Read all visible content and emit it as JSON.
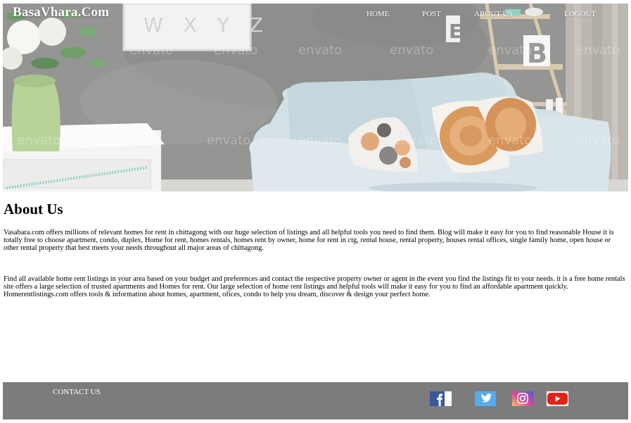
{
  "header": {
    "brand": "BasaVhara.Com",
    "nav": [
      {
        "label": "HOME"
      },
      {
        "label": "POST"
      },
      {
        "label": "ABOUT US"
      },
      {
        "label": "LOGOUT"
      }
    ]
  },
  "hero": {
    "wall_letters": "W X Y Z",
    "shelf_letters": [
      "E",
      "B"
    ],
    "watermark": "envato"
  },
  "about": {
    "title": "About Us",
    "paragraphs": [
      "Vasabara.com offers millions of relevant homes for rent in chittagong with our huge selection of listings and all helpful tools you need to find them. Blog will make it easy for you to find reasonable House it is totally free to choose apartment, condo, duplex, Home for rent, homes rentals, homes rent by owner, home for rent in ctg, rental house, rental property, houses rental offices, single family home, open house or other rental property that best meets your needs throughout all major areas of chittagong.",
      "Find all available home rent listings in your area based on your budget and preferences and contact the respective property owner or agent in the event you find the listings fit to your needs. it is a free home rentals site offers a large selection of trusted apartments and Homes for rent. Our large selection of home rent listings and helpful tools will make it easy for you to find an affordable apartment quickly. Homerentlistings.com offers tools & information about homes, apartment, ofices, condo to help you dream, discover & design your perfect home."
    ]
  },
  "footer": {
    "contact_label": "CONTACT US",
    "social": [
      {
        "icon": "facebook-icon",
        "color": "#3b5998"
      },
      {
        "icon": "twitter-icon",
        "color": "#55acee"
      },
      {
        "icon": "instagram-icon",
        "color": "#c13584"
      },
      {
        "icon": "youtube-icon",
        "color": "#e62117"
      }
    ]
  },
  "colors": {
    "footer_bg": "#7c7c7c",
    "nav_text": "#ffffff"
  }
}
